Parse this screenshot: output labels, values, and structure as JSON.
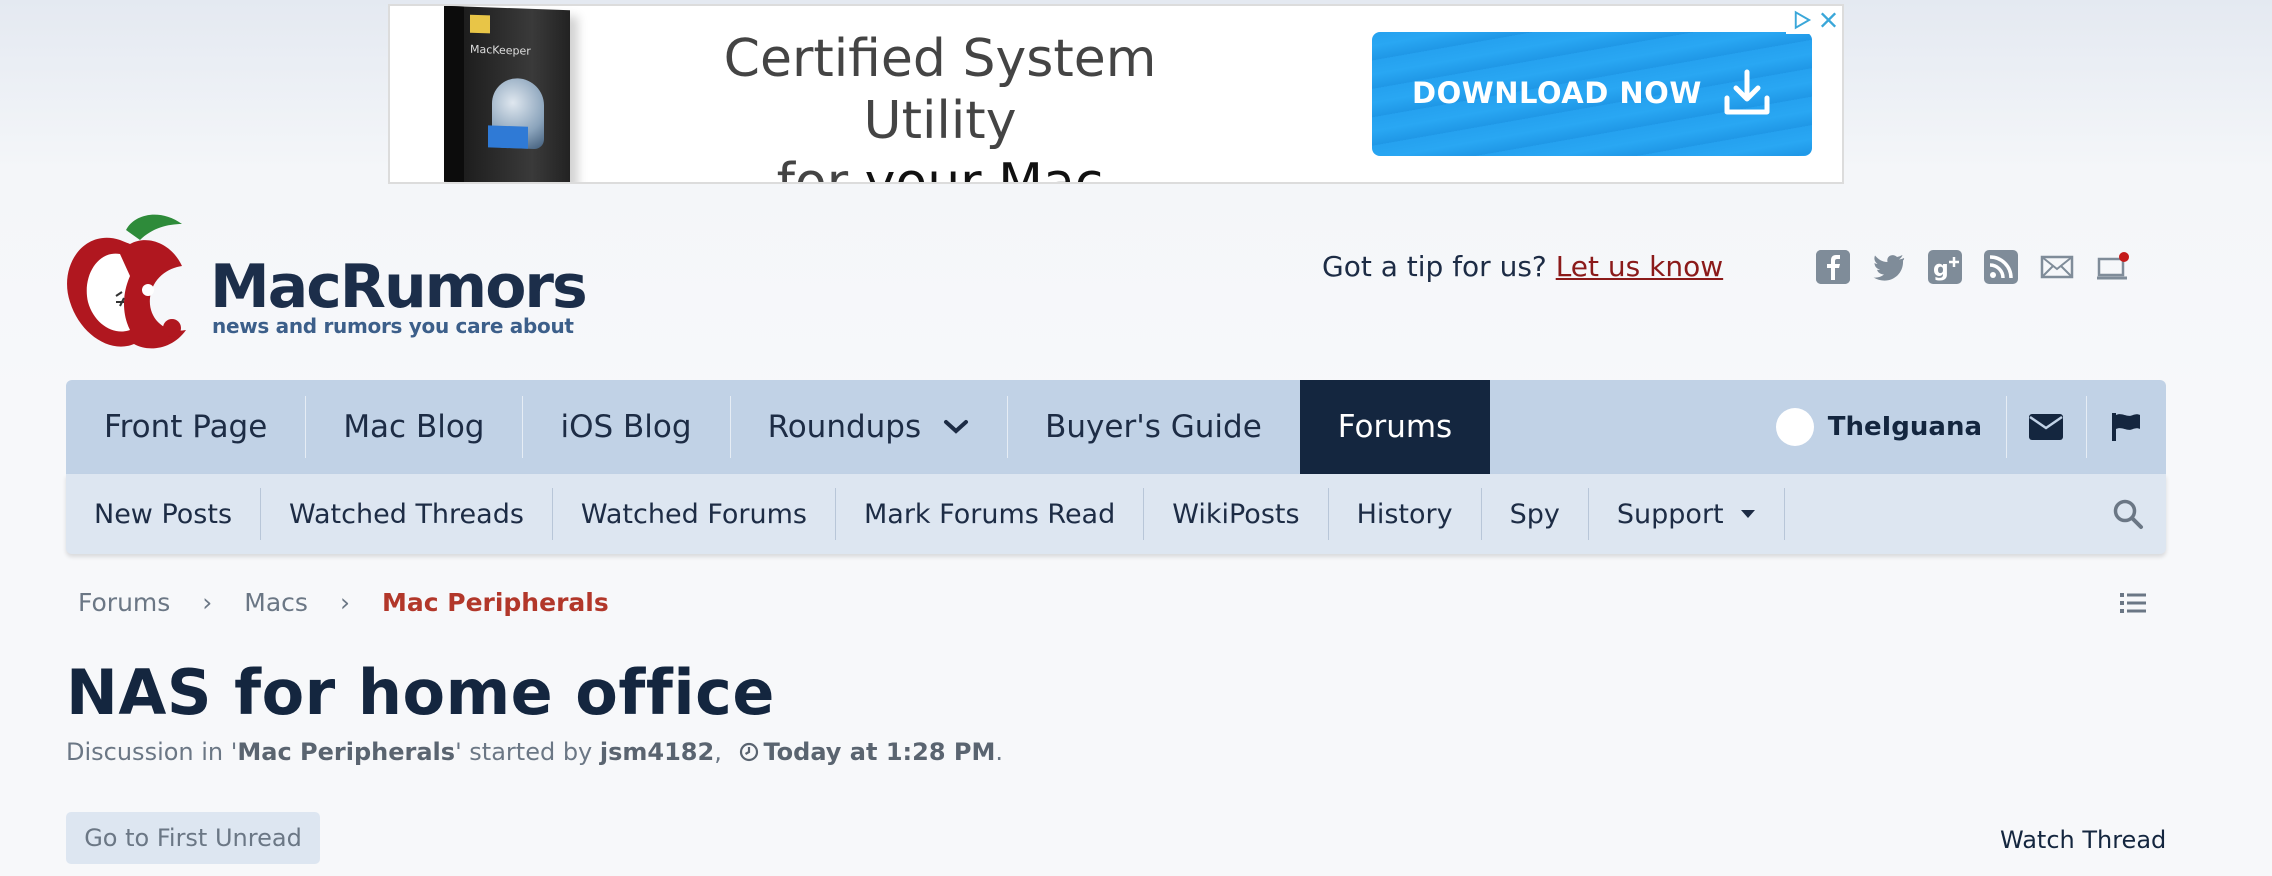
{
  "ad": {
    "headline_line1": "Certified System Utility",
    "headline_line2_prefix": "for ",
    "headline_line2_bold": "your Mac",
    "cta_label": "DOWNLOAD NOW",
    "box_name": "MacKeeper"
  },
  "header": {
    "logo_text": "MacRumors",
    "tagline": "news and rumors you care about",
    "tip_prefix": "Got a tip for us? ",
    "tip_link": "Let us know",
    "social_icons": [
      "facebook-icon",
      "twitter-icon",
      "google-plus-icon",
      "rss-icon",
      "mail-icon",
      "notification-icon"
    ]
  },
  "nav": {
    "items": [
      "Front Page",
      "Mac Blog",
      "iOS Blog",
      "Roundups",
      "Buyer's Guide",
      "Forums"
    ],
    "active": "Forums",
    "username": "TheIguana"
  },
  "subnav": {
    "items": [
      "New Posts",
      "Watched Threads",
      "Watched Forums",
      "Mark Forums Read",
      "WikiPosts",
      "History",
      "Spy",
      "Support"
    ]
  },
  "breadcrumb": {
    "items": [
      "Forums",
      "Macs"
    ],
    "current": "Mac Peripherals",
    "separator": "›"
  },
  "thread": {
    "title": "NAS for home office",
    "meta_prefix": "Discussion in '",
    "forum": "Mac Peripherals",
    "meta_mid": "' started by ",
    "author": "jsm4182",
    "meta_comma": ", ",
    "time": "Today at 1:28 PM",
    "meta_end": "."
  },
  "actions": {
    "first_unread": "Go to First Unread",
    "watch": "Watch Thread"
  },
  "colors": {
    "nav_bg": "#c1d2e6",
    "nav_active": "#14263f",
    "subnav_bg": "#dde6f1",
    "breadcrumb_current": "#b2372a",
    "cta_blue": "#25a1ef"
  }
}
